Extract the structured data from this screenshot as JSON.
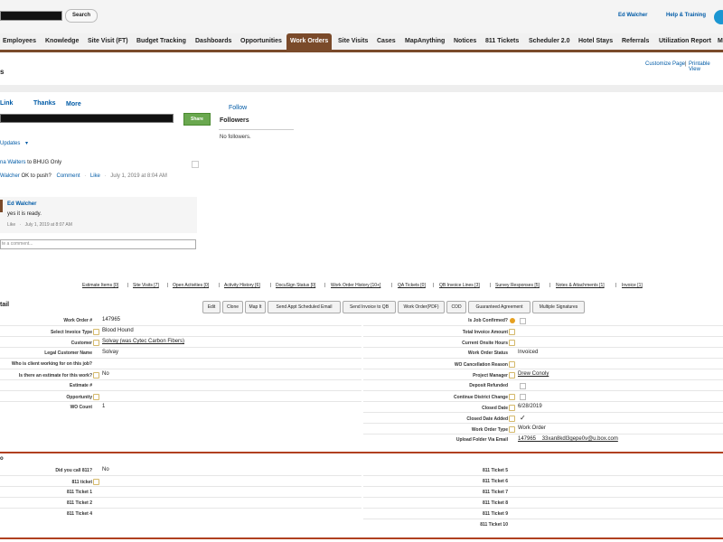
{
  "header": {
    "search_button": "Search",
    "user_name": "Ed Walcher",
    "help_label": "Help & Training"
  },
  "tabs": [
    "Employees",
    "Knowledge",
    "Site Visit (FT)",
    "Budget Tracking",
    "Dashboards",
    "Opportunities",
    "Work Orders",
    "Site Visits",
    "Cases",
    "MapAnything",
    "Notices",
    "811 Tickets",
    "Scheduler 2.0",
    "Hotel Stays",
    "Referrals",
    "Utilization Report",
    "M"
  ],
  "active_tab": "Work Orders",
  "page": {
    "title": "s",
    "customize_link": "Customize Page",
    "separator": "|",
    "printable_link": "Printable View"
  },
  "chatter": {
    "tabs": [
      "Link",
      "Thanks",
      "More"
    ],
    "share_button": "Share",
    "follow_link": "Follow",
    "followers_heading": "Followers",
    "no_followers": "No followers.",
    "updates_filter": "Updates",
    "updates_caret": "▾",
    "feed": {
      "author": "na Walters",
      "target": " to BHUG Only",
      "reply_author": "Walcher",
      "reply_text": " OK to push?",
      "comment_link": "Comment",
      "dot": "·",
      "like_link": "Like",
      "timestamp": "July 1, 2019 at 8:04 AM"
    },
    "comment": {
      "author": "Ed Walcher",
      "text": "yes it is ready.",
      "like": "Like",
      "timestamp": "July 1, 2019 at 8:07 AM"
    },
    "write_comment_placeholder": "te a comment..."
  },
  "related_links": [
    "Estimate Items [0]",
    "Site Visits [7]",
    "Open Activities [0]",
    "Activity History [6]",
    "DocuSign Status [0]",
    "Work Order History [10+]",
    "QA Tickets [0]",
    "QB Invoice Lines [3]",
    "Survey Responses [5]",
    "Notes & Attachments [1]",
    "Invoice [1]"
  ],
  "related_sep": "|",
  "detail": {
    "heading": "tail",
    "buttons": [
      "Edit",
      "Clone",
      "Map It",
      "Send Appt Scheduled Email",
      "Send Invoice to QB",
      "Work Order(PDF)",
      "COD",
      "Guaranteed Agreement",
      "Multiple Signatures"
    ],
    "left_fields": [
      {
        "label": "Work Order #",
        "value": "147965"
      },
      {
        "label": "Select Invoice Type",
        "value": "Blood Hound"
      },
      {
        "label": "Customer",
        "value": "Solvay (was Cytec Carbon Fibers)"
      },
      {
        "label": "Legal Customer Name",
        "value": "Solvay"
      },
      {
        "label": "Who is client working for on this job?",
        "value": ""
      },
      {
        "label": "Is there an estimate for this work?",
        "value": "No"
      },
      {
        "label": "Estimate #",
        "value": ""
      },
      {
        "label": "Opportunity",
        "value": ""
      },
      {
        "label": "WO Count",
        "value": "1"
      }
    ],
    "right_fields": [
      {
        "label": "Is Job Confirmed?",
        "value": ""
      },
      {
        "label": "Total Invoice Amount",
        "value": ""
      },
      {
        "label": "Current Onsite Hours",
        "value": ""
      },
      {
        "label": "Work Order Status",
        "value": "Invoiced"
      },
      {
        "label": "WO Cancellation Reason",
        "value": ""
      },
      {
        "label": "Project Manager",
        "value": "Drew Conoly"
      },
      {
        "label": "Deposit Refunded",
        "value": ""
      },
      {
        "label": "Continue District Change",
        "value": ""
      },
      {
        "label": "Closed Date",
        "value": "6/28/2019"
      },
      {
        "label": "Closed Date Added",
        "value": "✓"
      },
      {
        "label": "Work Order Type",
        "value": "Work Order"
      },
      {
        "label": "Upload Folder Via Email",
        "value": "147965__33xan8kdl3gepe0v@u.box.com"
      }
    ]
  },
  "ticket_section": {
    "heading": "o",
    "left_fields": [
      {
        "label": "Did you call 811?",
        "value": "No"
      },
      {
        "label": "811 ticket",
        "value": ""
      },
      {
        "label": "811 Ticket 1",
        "value": ""
      },
      {
        "label": "811 Ticket 2",
        "value": ""
      },
      {
        "label": "811 Ticket 4",
        "value": ""
      }
    ],
    "right_fields": [
      {
        "label": "811 Ticket 5",
        "value": ""
      },
      {
        "label": "811 Ticket 6",
        "value": ""
      },
      {
        "label": "811 Ticket 7",
        "value": ""
      },
      {
        "label": "811 Ticket 8",
        "value": ""
      },
      {
        "label": "811 Ticket 9",
        "value": ""
      },
      {
        "label": "811 Ticket 10",
        "value": ""
      }
    ]
  },
  "colors": {
    "accent": "#7a4a2a",
    "link": "#015ba7",
    "share": "#6aa84f",
    "section_rule": "#b04020"
  }
}
